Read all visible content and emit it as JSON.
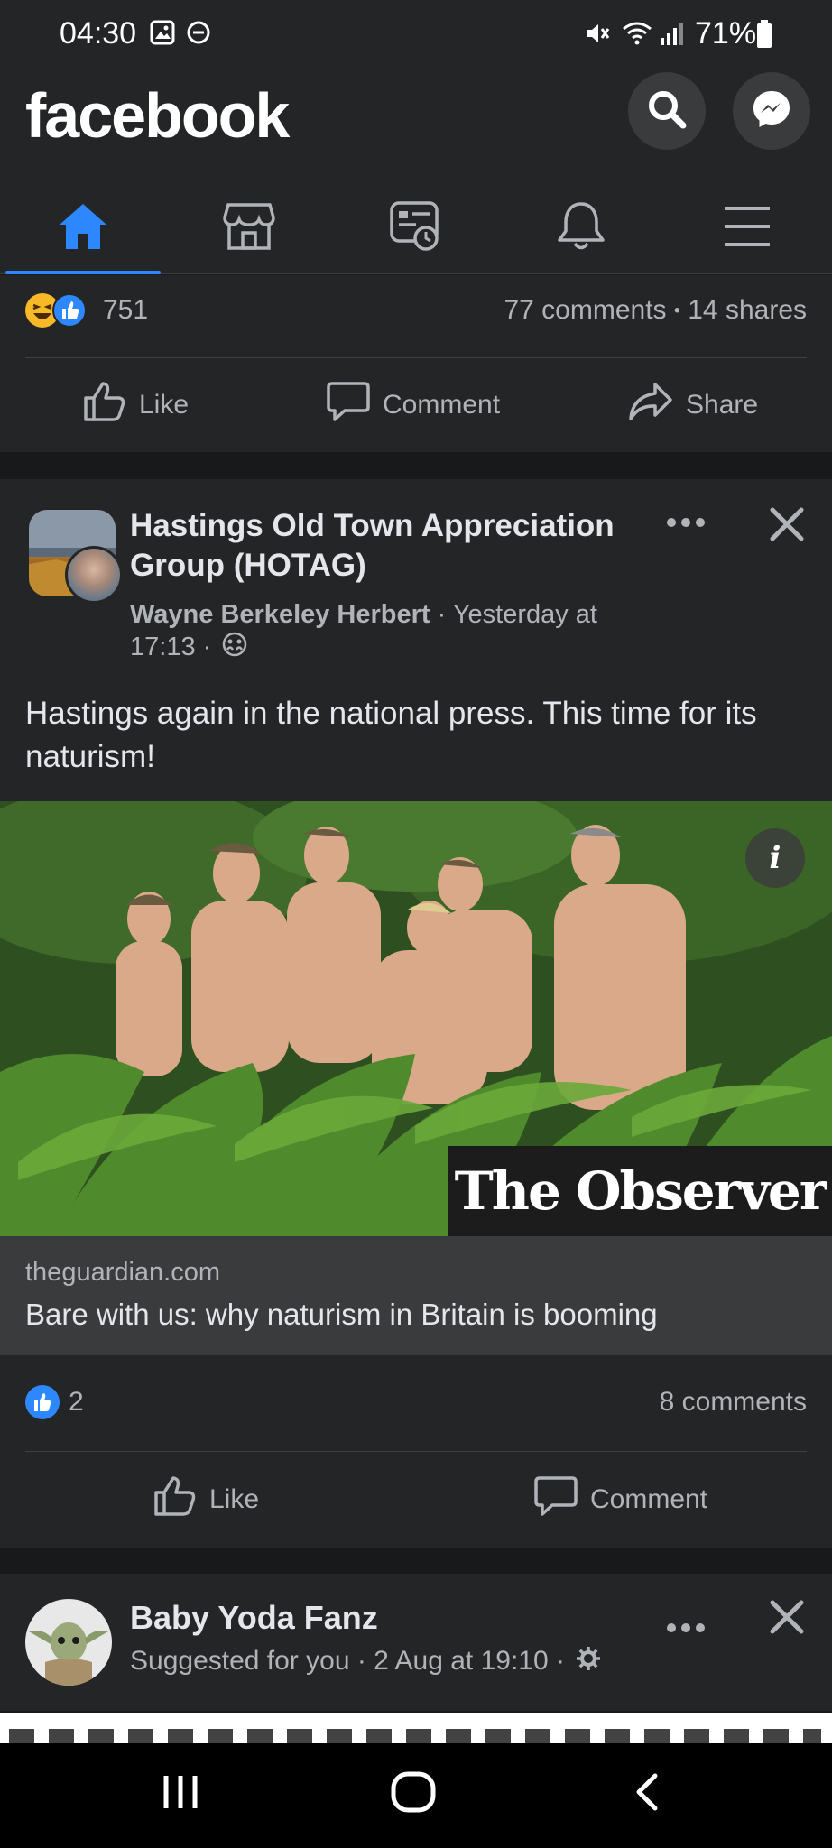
{
  "status_bar": {
    "time": "04:30",
    "battery": "71%",
    "icons": [
      "gallery-icon",
      "dnd-icon",
      "mute-icon",
      "wifi-icon",
      "signal-icon",
      "battery-icon"
    ]
  },
  "header": {
    "logo": "facebook",
    "icons": [
      "search-icon",
      "messenger-icon"
    ]
  },
  "tabs": [
    {
      "name": "home",
      "icon": "home-icon",
      "active": true
    },
    {
      "name": "marketplace",
      "icon": "marketplace-icon",
      "active": false
    },
    {
      "name": "news",
      "icon": "news-feed-icon",
      "active": false
    },
    {
      "name": "notifications",
      "icon": "bell-icon",
      "active": false
    },
    {
      "name": "menu",
      "icon": "hamburger-icon",
      "active": false
    }
  ],
  "previous_post": {
    "reaction_count": "751",
    "comments": "77 comments",
    "separator": "•",
    "shares": "14 shares",
    "actions": {
      "like": "Like",
      "comment": "Comment",
      "share": "Share"
    }
  },
  "post": {
    "group_name": "Hastings Old Town Appreciation Group (HOTAG)",
    "author": "Wayne Berkeley Herbert",
    "meta_rest": " · Yesterday at 17:13 ·",
    "text": "Hastings again in the national press. This time for its naturism!",
    "link": {
      "domain": "theguardian.com",
      "title": "Bare with us: why naturism in Britain is booming",
      "brand": "The Observer",
      "info": "i"
    },
    "reaction_count": "2",
    "comments": "8 comments",
    "actions": {
      "like": "Like",
      "comment": "Comment"
    }
  },
  "next_post": {
    "name": "Baby Yoda Fanz",
    "meta": "Suggested for you · 2 Aug at 19:10 ·"
  },
  "colors": {
    "background": "#18191a",
    "card": "#242526",
    "accent": "#2d88ff",
    "text_primary": "#e4e6eb",
    "text_secondary": "#b0b3b8"
  }
}
